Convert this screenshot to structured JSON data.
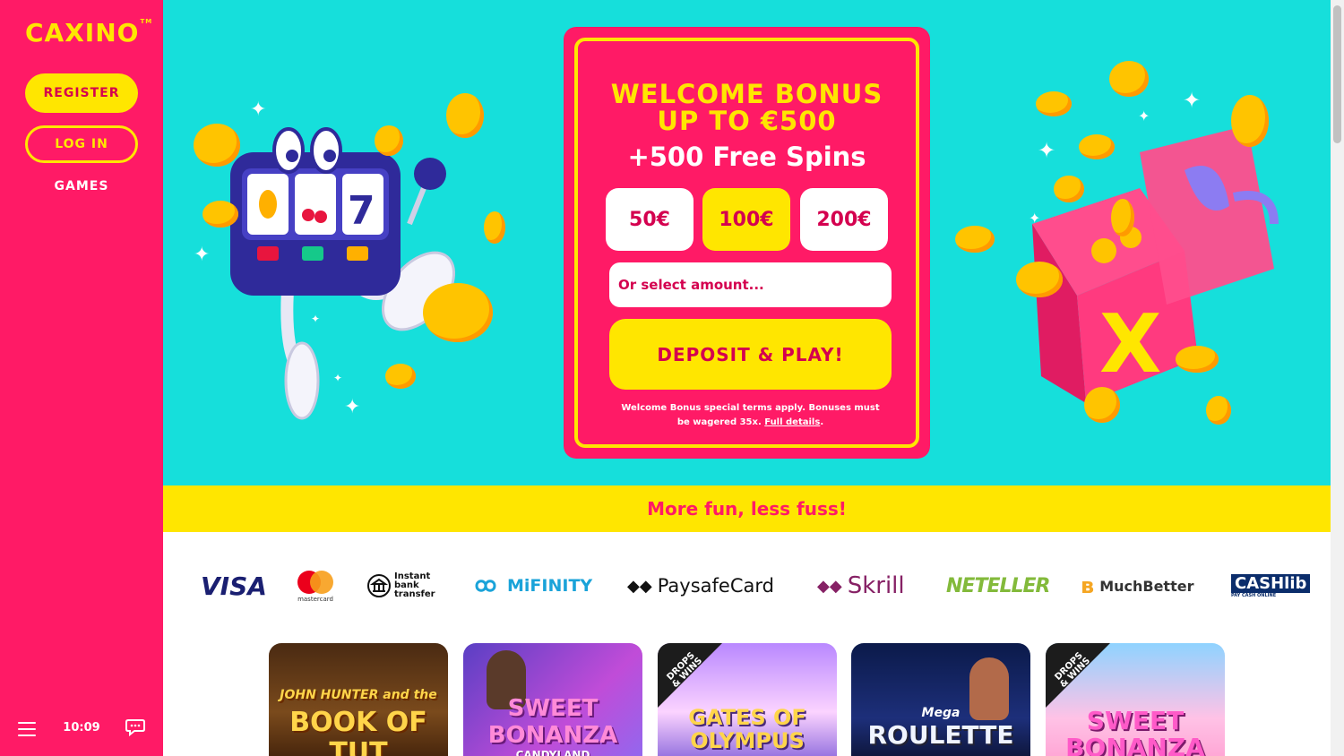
{
  "brand": {
    "logo": "CAXINO",
    "trademark": "TM"
  },
  "sidebar": {
    "register_label": "REGISTER",
    "login_label": "LOG IN",
    "games_label": "GAMES",
    "clock": "10:09"
  },
  "bonus": {
    "line1": "WELCOME BONUS",
    "line2": "UP TO €500",
    "spins": "+500 Free Spins",
    "amounts": [
      "50€",
      "100€",
      "200€"
    ],
    "selected_amount": "100€",
    "amount_placeholder": "Or select amount...",
    "deposit_label": "DEPOSIT & PLAY!",
    "terms_text": "Welcome Bonus special terms apply. Bonuses must be wagered 35x. ",
    "terms_link": "Full details",
    "terms_end": "."
  },
  "banner": {
    "text": "More fun, less fuss!"
  },
  "payments": {
    "visa": "VISA",
    "mastercard": "mastercard",
    "instant_bank": "Instant bank transfer",
    "mifinity": "MiFINITY",
    "paysafecard": "PaysafeCard",
    "skrill": "Skrill",
    "neteller": "NETELLER",
    "muchbetter": "MuchBetter",
    "cashlib": "CASHlib",
    "cashlib_sub": "PAY CASH ONLINE"
  },
  "games": [
    {
      "title_small": "JOHN HUNTER and the",
      "title": "BOOK OF TUT",
      "badge": ""
    },
    {
      "title_small": "",
      "title": "SWEET BONANZA",
      "subtitle": "CANDYLAND",
      "badge": ""
    },
    {
      "title_small": "",
      "title": "GATES OF OLYMPUS",
      "badge": "DROPS & WINS"
    },
    {
      "title_small": "Mega",
      "title": "ROULETTE",
      "badge": ""
    },
    {
      "title_small": "",
      "title": "SWEET BONANZA",
      "badge": "DROPS & WINS"
    }
  ],
  "colors": {
    "brand_pink": "#ff1a66",
    "brand_yellow": "#ffe600",
    "hero_teal": "#16dfdb"
  }
}
